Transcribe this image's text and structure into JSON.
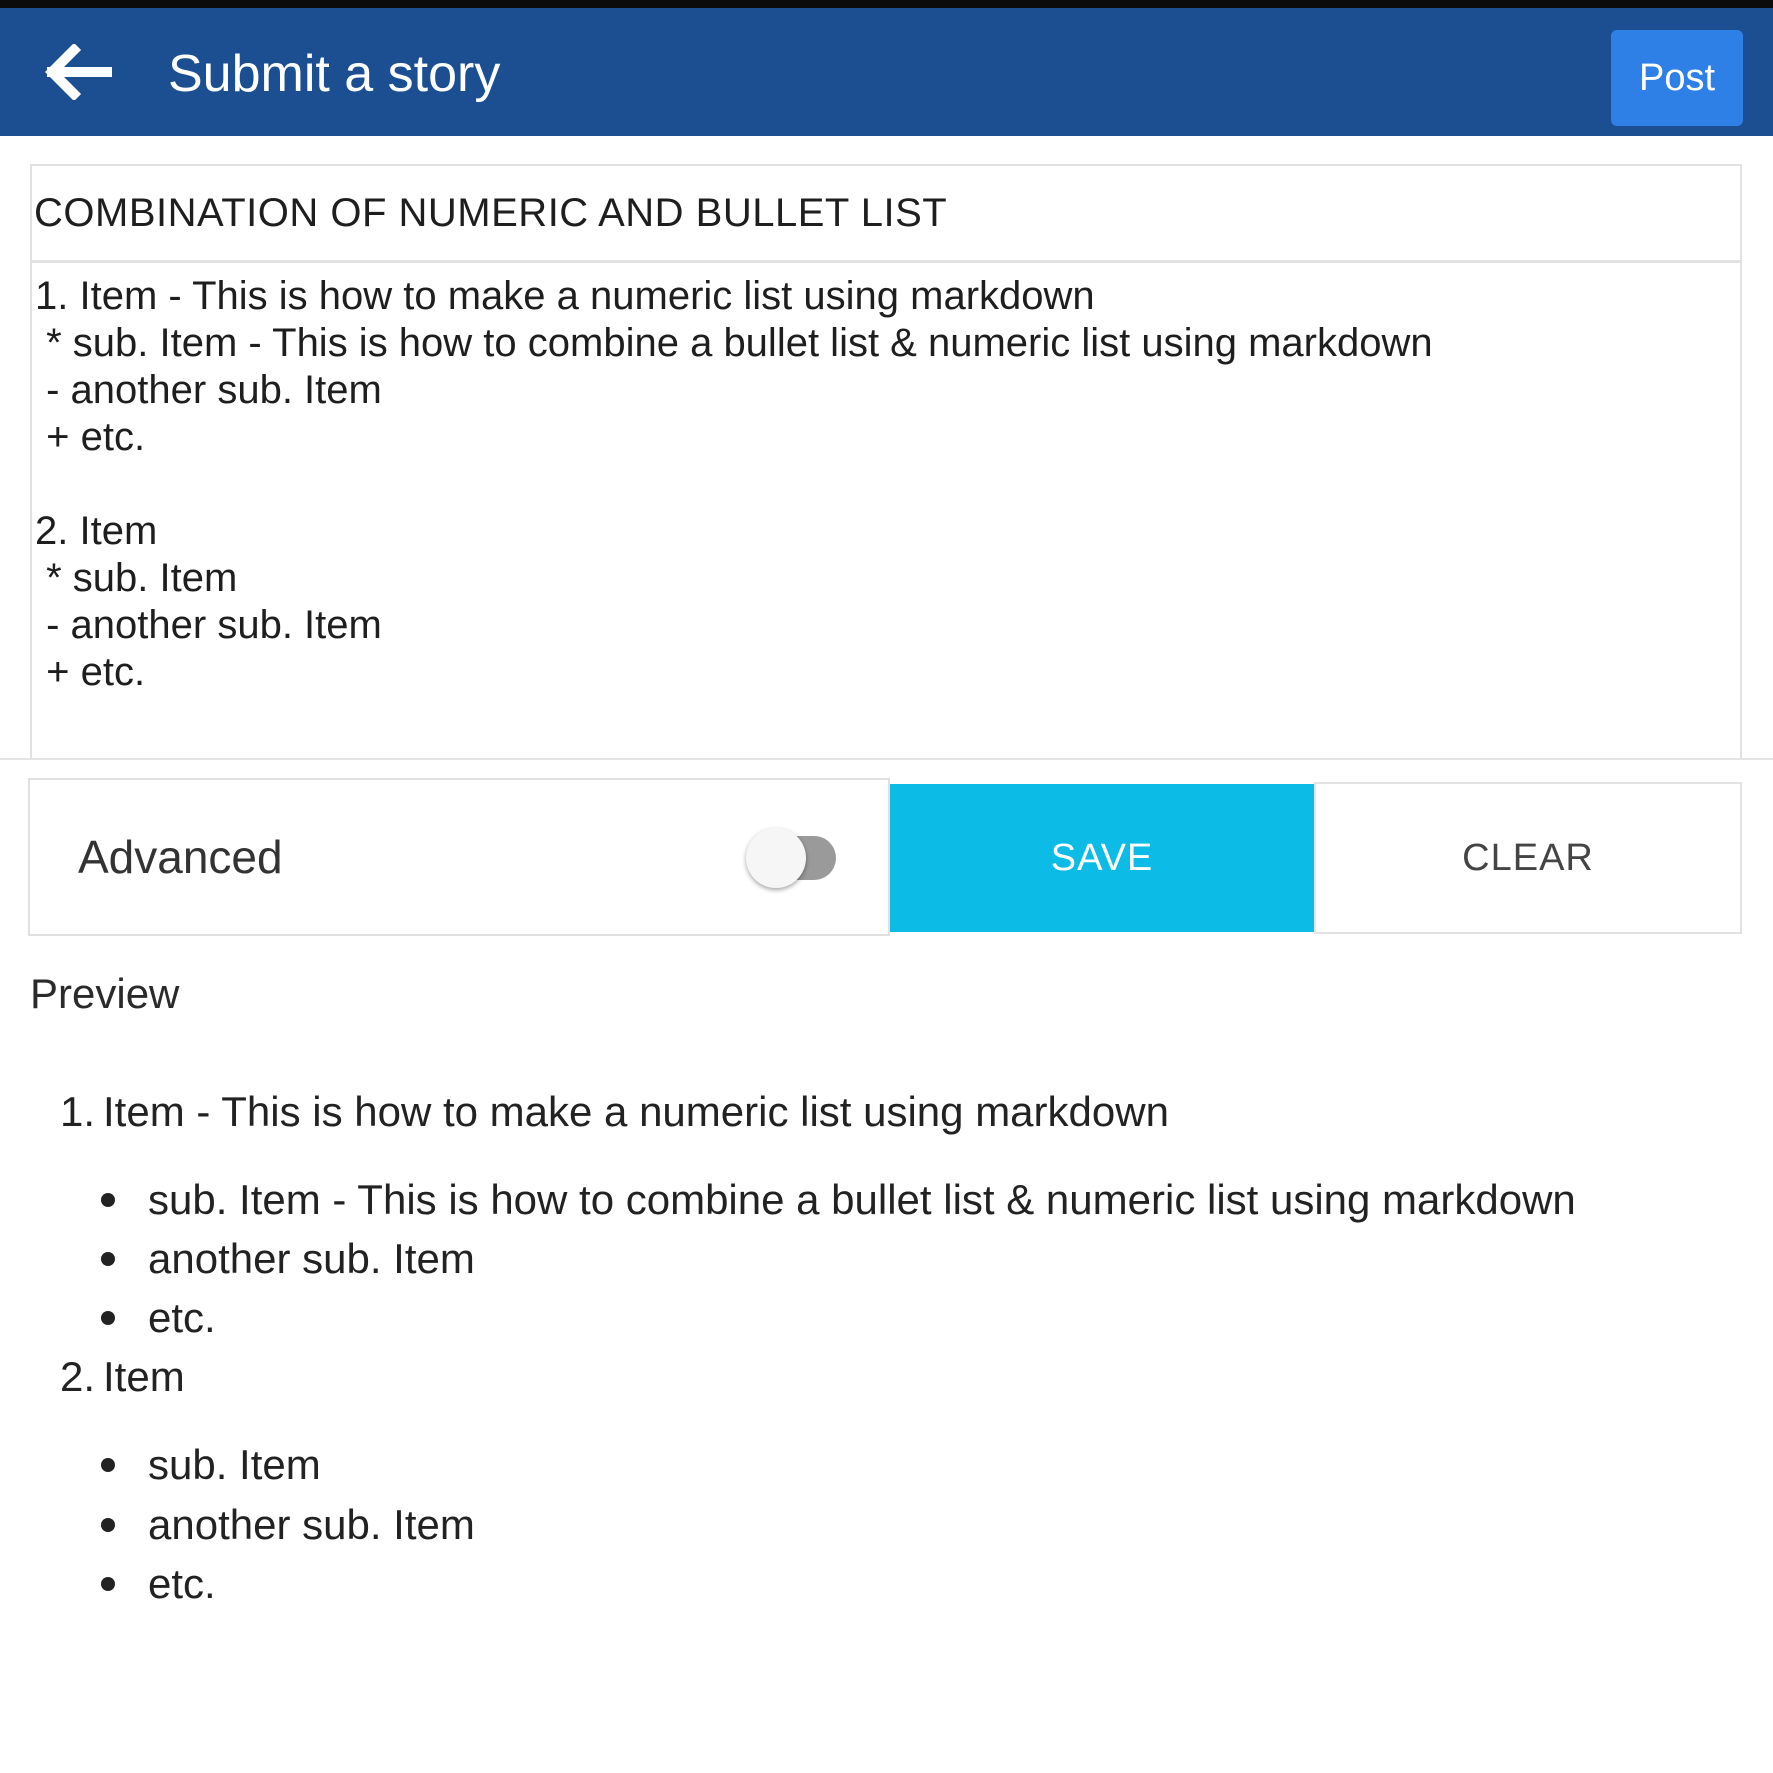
{
  "app_bar": {
    "title": "Submit a story",
    "post_label": "Post",
    "back_icon": "arrow-left-icon",
    "color": "#1b4f92"
  },
  "editor": {
    "title_value": "COMBINATION OF NUMERIC AND BULLET LIST",
    "body_value": "1. Item - This is how to make a numeric list using markdown\n * sub. Item - This is how to combine a bullet list & numeric list using markdown\n - another sub. Item\n + etc.\n\n2. Item\n * sub. Item\n - another sub. Item\n + etc."
  },
  "controls": {
    "advanced_label": "Advanced",
    "advanced_enabled": false,
    "save_label": "SAVE",
    "clear_label": "CLEAR",
    "save_color": "#0cbbe6"
  },
  "preview": {
    "label": "Preview",
    "items": [
      {
        "number": "1.",
        "text": "Item - This is how to make a numeric list using markdown",
        "subitems": [
          "sub. Item - This is how to combine a bullet list & numeric list using markdown",
          "another sub. Item",
          "etc."
        ]
      },
      {
        "number": "2.",
        "text": "Item",
        "subitems": [
          "sub. Item",
          "another sub. Item",
          "etc."
        ]
      }
    ]
  }
}
